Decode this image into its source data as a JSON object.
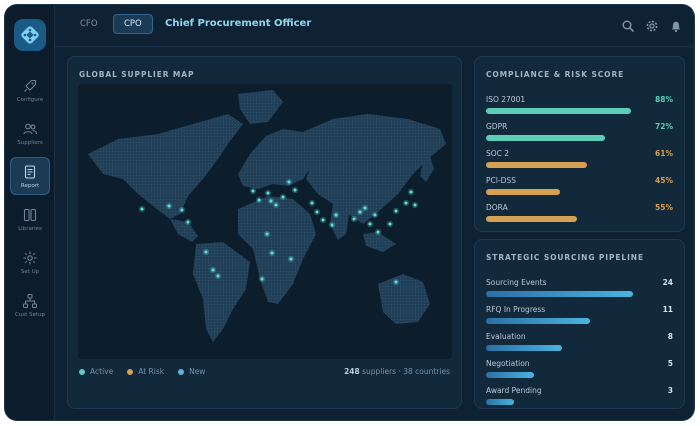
{
  "sidebar": {
    "items": [
      {
        "label": "Configure",
        "icon": "rocket-icon",
        "active": false
      },
      {
        "label": "Suppliers",
        "icon": "users-icon",
        "active": false
      },
      {
        "label": "Report",
        "icon": "document-icon",
        "active": true
      },
      {
        "label": "Libraries",
        "icon": "columns-icon",
        "active": false
      },
      {
        "label": "Set Up",
        "icon": "settings-icon",
        "active": false
      },
      {
        "label": "Cust Setup",
        "icon": "hierarchy-icon",
        "active": false
      }
    ]
  },
  "header": {
    "tabs": [
      {
        "label": "CFO",
        "active": false
      },
      {
        "label": "CPO",
        "active": true
      }
    ],
    "title": "Chief Procurement Officer",
    "icons": [
      "search-icon",
      "gear-icon",
      "bell-icon"
    ]
  },
  "map": {
    "title": "GLOBAL SUPPLIER MAP",
    "legend": [
      {
        "label": "Active",
        "color": "#5ec9c6"
      },
      {
        "label": "At Risk",
        "color": "#d6a052"
      },
      {
        "label": "New",
        "color": "#5fb3d6"
      }
    ],
    "summary_count": "248",
    "summary_text": "suppliers · 38 countries",
    "point_color": "#5fe0d8"
  },
  "compliance": {
    "title": "COMPLIANCE & RISK SCORE",
    "items": [
      {
        "name": "ISO 27001",
        "value": "88%",
        "pct": 0.88,
        "status": "good",
        "color": "#5ecdb8"
      },
      {
        "name": "GDPR",
        "value": "72%",
        "pct": 0.72,
        "status": "good",
        "color": "#5ecdb8"
      },
      {
        "name": "SOC 2",
        "value": "61%",
        "pct": 0.61,
        "status": "warn",
        "color": "#d6a052"
      },
      {
        "name": "PCI-DSS",
        "value": "45%",
        "pct": 0.45,
        "status": "warn",
        "color": "#d6a052"
      },
      {
        "name": "DORA",
        "value": "55%",
        "pct": 0.55,
        "status": "warn",
        "color": "#d6a052"
      }
    ]
  },
  "pipeline": {
    "title": "STRATEGIC SOURCING PIPELINE",
    "items": [
      {
        "name": "Sourcing Events",
        "value": "24",
        "pct": 0.89
      },
      {
        "name": "RFQ In Progress",
        "value": "11",
        "pct": 0.63
      },
      {
        "name": "Evaluation",
        "value": "8",
        "pct": 0.46
      },
      {
        "name": "Negotiation",
        "value": "5",
        "pct": 0.29
      },
      {
        "name": "Award Pending",
        "value": "3",
        "pct": 0.17
      }
    ],
    "bar_color": "#3a9ad0"
  },
  "colors": {
    "background": "#0f2233",
    "panel": "#12283b",
    "accent": "#8ed7ee",
    "good": "#5ecdb8",
    "warn": "#d6a052"
  }
}
